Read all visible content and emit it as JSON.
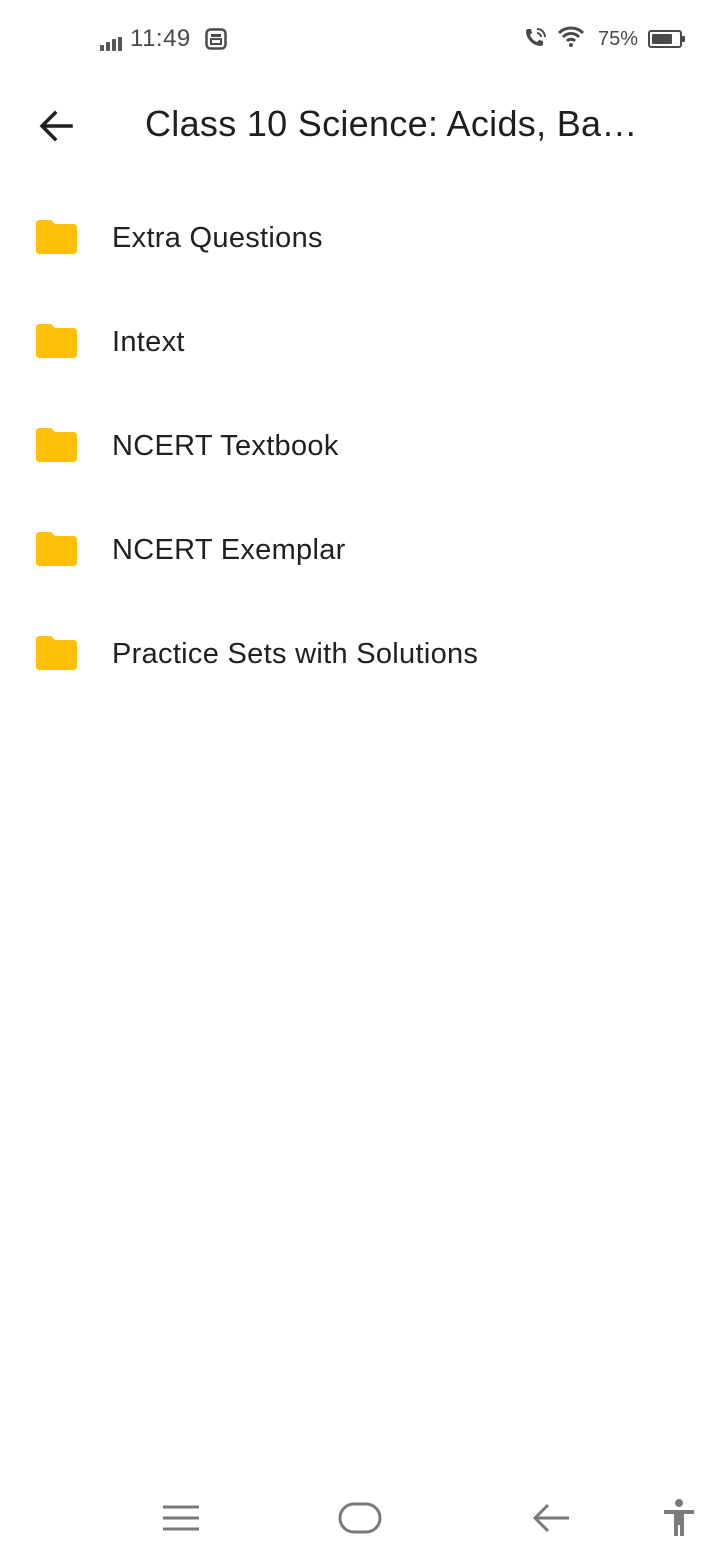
{
  "status_bar": {
    "time": "11:49",
    "battery_percent": "75%",
    "battery_level": 0.75,
    "icons": [
      "signal-icon",
      "notification-icon",
      "wifi-calling-icon",
      "wifi-icon",
      "battery-icon"
    ]
  },
  "app_bar": {
    "back_icon": "arrow-back-icon",
    "title": "Class 10 Science: Acids, Ba…"
  },
  "folders": [
    {
      "label": "Extra Questions",
      "icon": "folder-icon"
    },
    {
      "label": "Intext",
      "icon": "folder-icon"
    },
    {
      "label": "NCERT Textbook",
      "icon": "folder-icon"
    },
    {
      "label": "NCERT Exemplar",
      "icon": "folder-icon"
    },
    {
      "label": "Practice Sets with Solutions",
      "icon": "folder-icon"
    }
  ],
  "nav_bar": {
    "icons": [
      "menu-icon",
      "home-icon",
      "back-icon",
      "accessibility-icon"
    ]
  },
  "colors": {
    "folder": "#FFC107",
    "text": "#202124",
    "status_text": "#4a4a4a",
    "nav_icon": "#7a7a7a"
  }
}
